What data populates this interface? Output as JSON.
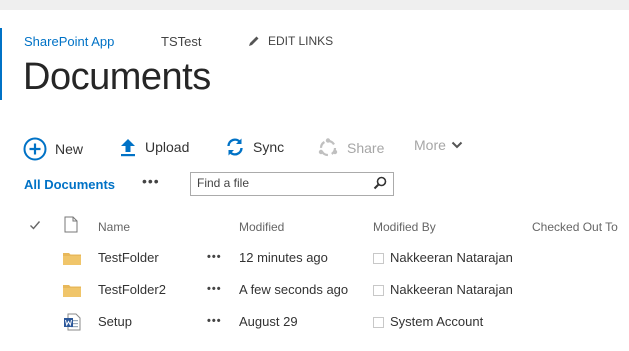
{
  "topnav": {
    "app_link": "SharePoint App",
    "site_link": "TSTest",
    "edit_links": "EDIT LINKS"
  },
  "page": {
    "title": "Documents"
  },
  "commands": {
    "new": "New",
    "upload": "Upload",
    "sync": "Sync",
    "share": "Share",
    "more": "More"
  },
  "view": {
    "current": "All Documents",
    "ellipsis": "•••",
    "search_placeholder": "Find a file"
  },
  "columns": {
    "name": "Name",
    "modified": "Modified",
    "modified_by": "Modified By",
    "checked_out_to": "Checked Out To"
  },
  "rows": [
    {
      "type": "folder",
      "icon": "folder-icon",
      "name": "TestFolder",
      "menu": "•••",
      "modified": "12 minutes ago",
      "modified_by": "Nakkeeran Natarajan"
    },
    {
      "type": "folder",
      "icon": "folder-icon",
      "name": "TestFolder2",
      "menu": "•••",
      "modified": "A few seconds ago",
      "modified_by": "Nakkeeran Natarajan"
    },
    {
      "type": "word",
      "icon": "word-document-icon",
      "name": "Setup",
      "menu": "•••",
      "modified": "August 29",
      "modified_by": "System Account"
    }
  ],
  "colors": {
    "accent": "#0072c6",
    "folder": "#e8b85a",
    "disabled": "#a6a6a6"
  }
}
